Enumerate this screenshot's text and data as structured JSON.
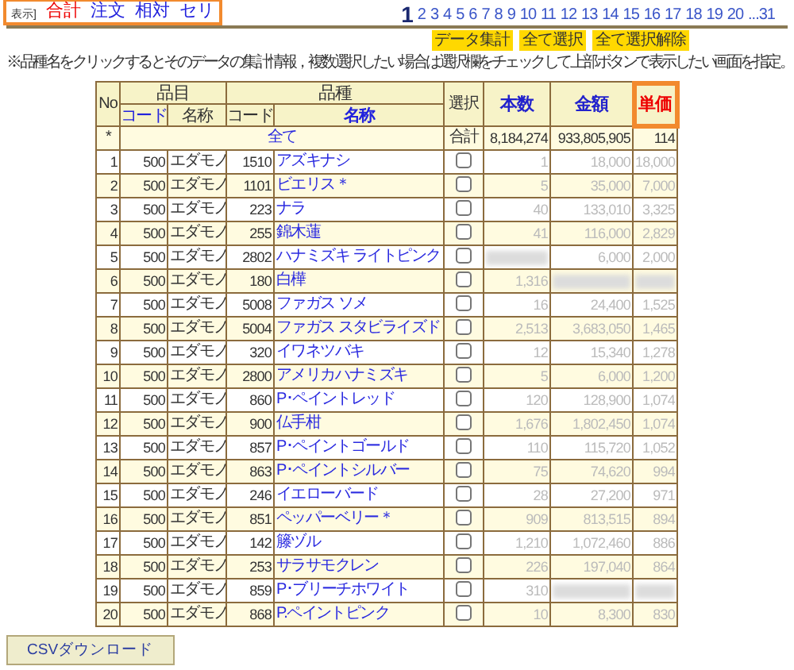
{
  "display_label": "表示]",
  "display_tabs": [
    {
      "label": "合計",
      "selected": true
    },
    {
      "label": "注文",
      "selected": false
    },
    {
      "label": "相対",
      "selected": false
    },
    {
      "label": "セリ",
      "selected": false
    }
  ],
  "pages": [
    {
      "label": "1",
      "selected": true
    },
    {
      "label": "2",
      "selected": false
    },
    {
      "label": "3",
      "selected": false
    },
    {
      "label": "4",
      "selected": false
    },
    {
      "label": "5",
      "selected": false
    },
    {
      "label": "6",
      "selected": false
    },
    {
      "label": "7",
      "selected": false
    },
    {
      "label": "8",
      "selected": false
    },
    {
      "label": "9",
      "selected": false
    },
    {
      "label": "10",
      "selected": false
    },
    {
      "label": "11",
      "selected": false
    },
    {
      "label": "12",
      "selected": false
    },
    {
      "label": "13",
      "selected": false
    },
    {
      "label": "14",
      "selected": false
    },
    {
      "label": "15",
      "selected": false
    },
    {
      "label": "16",
      "selected": false
    },
    {
      "label": "17",
      "selected": false
    },
    {
      "label": "18",
      "selected": false
    },
    {
      "label": "19",
      "selected": false
    },
    {
      "label": "20",
      "selected": false
    },
    {
      "label": "...31",
      "selected": false
    }
  ],
  "action_buttons": [
    "データ集計",
    "全て選択",
    "全て選択解除"
  ],
  "note": "※品種名をクリックするとそのデータの集計情報，複数選択したい場合は選択欄をチェックして上部ボタンで表示したい画面を指定。",
  "table": {
    "no_header": "No",
    "groups": [
      "品目",
      "品種"
    ],
    "sub_headers": [
      {
        "label": "コード",
        "link": true
      },
      {
        "label": "名称",
        "link": false
      },
      {
        "label": "コード",
        "link": false
      },
      {
        "label": "名称",
        "link": true
      }
    ],
    "select_header": "選択",
    "value_headers": [
      {
        "label": "本数",
        "highlighted": false
      },
      {
        "label": "金額",
        "highlighted": false
      },
      {
        "label": "単価",
        "highlighted": true
      }
    ],
    "total_row": {
      "marker": "*",
      "label": "全て",
      "select_label": "合計",
      "count": "8,184,274",
      "amount": "933,805,905",
      "unit": "114"
    },
    "rows": [
      {
        "no": "1",
        "code": "500",
        "name": "エダモノ",
        "variety_code": "1510",
        "variety": "アズキナシ",
        "checked": false,
        "count": "1",
        "amount": "18,000",
        "unit": "18,000"
      },
      {
        "no": "2",
        "code": "500",
        "name": "エダモノ",
        "variety_code": "1101",
        "variety": "ビエリス＊",
        "checked": false,
        "count": "5",
        "amount": "35,000",
        "unit": "7,000"
      },
      {
        "no": "3",
        "code": "500",
        "name": "エダモノ",
        "variety_code": "223",
        "variety": "ナラ",
        "checked": false,
        "count": "40",
        "amount": "133,010",
        "unit": "3,325"
      },
      {
        "no": "4",
        "code": "500",
        "name": "エダモノ",
        "variety_code": "255",
        "variety": "錦木蓮",
        "checked": false,
        "count": "41",
        "amount": "116,000",
        "unit": "2,829"
      },
      {
        "no": "5",
        "code": "500",
        "name": "エダモノ",
        "variety_code": "2802",
        "variety": "ハナミズキ ライトピンク",
        "checked": false,
        "amount": "6,000",
        "unit": "2,000"
      },
      {
        "no": "6",
        "code": "500",
        "name": "エダモノ",
        "variety_code": "180",
        "variety": "白樺",
        "checked": false,
        "count": "1,316"
      },
      {
        "no": "7",
        "code": "500",
        "name": "エダモノ",
        "variety_code": "5008",
        "variety": "ファガス ソメ",
        "checked": false,
        "count": "16",
        "amount": "24,400",
        "unit": "1,525"
      },
      {
        "no": "8",
        "code": "500",
        "name": "エダモノ",
        "variety_code": "5004",
        "variety": "ファガス スタビライズド",
        "checked": false,
        "count": "2,513",
        "amount": "3,683,050",
        "unit": "1,465"
      },
      {
        "no": "9",
        "code": "500",
        "name": "エダモノ",
        "variety_code": "320",
        "variety": "イワネツバキ",
        "checked": false,
        "count": "12",
        "amount": "15,340",
        "unit": "1,278"
      },
      {
        "no": "10",
        "code": "500",
        "name": "エダモノ",
        "variety_code": "2800",
        "variety": "アメリカハナミズキ",
        "checked": false,
        "count": "5",
        "amount": "6,000",
        "unit": "1,200"
      },
      {
        "no": "11",
        "code": "500",
        "name": "エダモノ",
        "variety_code": "860",
        "variety": "P･ペイントレッド",
        "checked": false,
        "count": "120",
        "amount": "128,900",
        "unit": "1,074"
      },
      {
        "no": "12",
        "code": "500",
        "name": "エダモノ",
        "variety_code": "900",
        "variety": "仏手柑",
        "checked": false,
        "count": "1,676",
        "amount": "1,802,450",
        "unit": "1,074"
      },
      {
        "no": "13",
        "code": "500",
        "name": "エダモノ",
        "variety_code": "857",
        "variety": "P･ペイントゴールド",
        "checked": false,
        "count": "110",
        "amount": "115,720",
        "unit": "1,052"
      },
      {
        "no": "14",
        "code": "500",
        "name": "エダモノ",
        "variety_code": "863",
        "variety": "P･ペイントシルバー",
        "checked": false,
        "count": "75",
        "amount": "74,620",
        "unit": "994"
      },
      {
        "no": "15",
        "code": "500",
        "name": "エダモノ",
        "variety_code": "246",
        "variety": "イエローバード",
        "checked": false,
        "count": "28",
        "amount": "27,200",
        "unit": "971"
      },
      {
        "no": "16",
        "code": "500",
        "name": "エダモノ",
        "variety_code": "851",
        "variety": "ペッパーベリー＊",
        "checked": false,
        "count": "909",
        "amount": "813,515",
        "unit": "894"
      },
      {
        "no": "17",
        "code": "500",
        "name": "エダモノ",
        "variety_code": "142",
        "variety": "籐ヅル",
        "checked": false,
        "count": "1,210",
        "amount": "1,072,460",
        "unit": "886"
      },
      {
        "no": "18",
        "code": "500",
        "name": "エダモノ",
        "variety_code": "253",
        "variety": "サラサモクレン",
        "checked": false,
        "count": "226",
        "amount": "197,040",
        "unit": "864"
      },
      {
        "no": "19",
        "code": "500",
        "name": "エダモノ",
        "variety_code": "859",
        "variety": "P･ブリーチホワイト",
        "checked": false,
        "count": "310"
      },
      {
        "no": "20",
        "code": "500",
        "name": "エダモノ",
        "variety_code": "868",
        "variety": "P.ペイントピンク",
        "checked": false,
        "count": "10",
        "amount": "8,300",
        "unit": "830"
      }
    ]
  },
  "download_button": "CSVダウンロード"
}
